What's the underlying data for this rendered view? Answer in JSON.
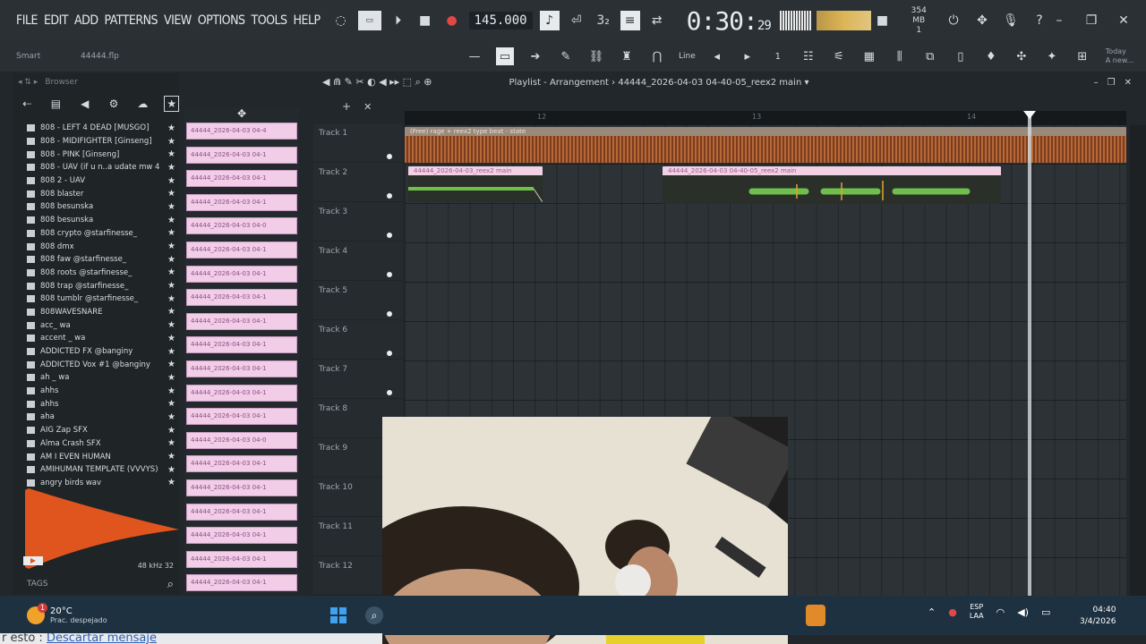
{
  "menu": [
    "FILE",
    "EDIT",
    "ADD",
    "PATTERNS",
    "VIEW",
    "OPTIONS",
    "TOOLS",
    "HELP"
  ],
  "transport": {
    "tempo": "145.000",
    "time_main": "0:30:",
    "time_sub": "29",
    "memory": "354 MB",
    "memory_sub": "1"
  },
  "toolbar2": {
    "pattern": "Smart",
    "file": "44444.flp",
    "snap": "Line",
    "today": "Today",
    "today_sub": "A new..."
  },
  "browser": {
    "title": "Browser",
    "items": [
      "808 - LEFT 4 DEAD [MUSGO]",
      "808 - MIDIFIGHTER [Ginseng]",
      "808 - PINK [Ginseng]",
      "808 - UAV (if u n..a udate mw 4 EQ)",
      "808 2 - UAV",
      "808 blaster",
      "808 besunska",
      "808 besunska",
      "808 crypto @starfinesse_",
      "808 dmx",
      "808 faw @starfinesse_",
      "808 roots @starfinesse_",
      "808 trap @starfinesse_",
      "808 tumblr @starfinesse_",
      "808WAVESNARE",
      "acc_ wa",
      "accent _ wa",
      "ADDICTED FX @banginy",
      "ADDICTED Vox #1 @banginy",
      "ah _ wa",
      "ahhs",
      "ahhs",
      "aha",
      "AIG Zap SFX",
      "Alma Crash SFX",
      "AM I EVEN HUMAN",
      "AMIHUMAN TEMPLATE (VVVYS)",
      "angry birds wav"
    ],
    "preview_info": "48 kHz 32",
    "tags_label": "TAGS"
  },
  "picker": {
    "clips": [
      "44444_2026-04-03 04-4",
      "44444_2026-04-03 04-1",
      "44444_2026-04-03 04-1",
      "44444_2026-04-03 04-1",
      "44444_2026-04-03 04-0",
      "44444_2026-04-03 04-1",
      "44444_2026-04-03 04-1",
      "44444_2026-04-03 04-1",
      "44444_2026-04-03 04-1",
      "44444_2026-04-03 04-1",
      "44444_2026-04-03 04-1",
      "44444_2026-04-03 04-1",
      "44444_2026-04-03 04-1",
      "44444_2026-04-03 04-0",
      "44444_2026-04-03 04-1",
      "44444_2026-04-03 04-1",
      "44444_2026-04-03 04-1",
      "44444_2026-04-03 04-1",
      "44444_2026-04-03 04-1",
      "44444_2026-04-03 04-1",
      "44444_2026-04-03 04-1",
      "44444_2026-04-03 04-1"
    ]
  },
  "playlist": {
    "title": "Playlist - Arrangement",
    "arrangement_name": "44444_2026-04-03 04-40-05_reex2 main",
    "tracks": [
      "Track 1",
      "Track 2",
      "Track 3",
      "Track 4",
      "Track 5",
      "Track 6",
      "Track 7",
      "Track 8",
      "Track 9",
      "Track 10",
      "Track 11",
      "Track 12"
    ],
    "ruler": [
      "12",
      "13",
      "14"
    ],
    "clip_track1": "(Free) rage + reex2 type beat - state",
    "clip_track2a": "44444_2026-04-03_reex2 main",
    "clip_track2b": "44444_2026-04-03 04-40-05_reex2 main"
  },
  "taskbar": {
    "temperature": "20°C",
    "weather": "Prac. despejado",
    "weather_badge": "1",
    "lang_top": "ESP",
    "lang_bottom": "LAA",
    "time": "04:40",
    "date": "3/4/2026"
  },
  "chat": {
    "prefix": "r esto :",
    "link": "Descartar mensaje"
  },
  "colors": {
    "accent_orange": "#e0541d",
    "clip_pink": "#f1cde8",
    "wave_green": "#6fbf4a",
    "taskbar": "#1d3141"
  }
}
